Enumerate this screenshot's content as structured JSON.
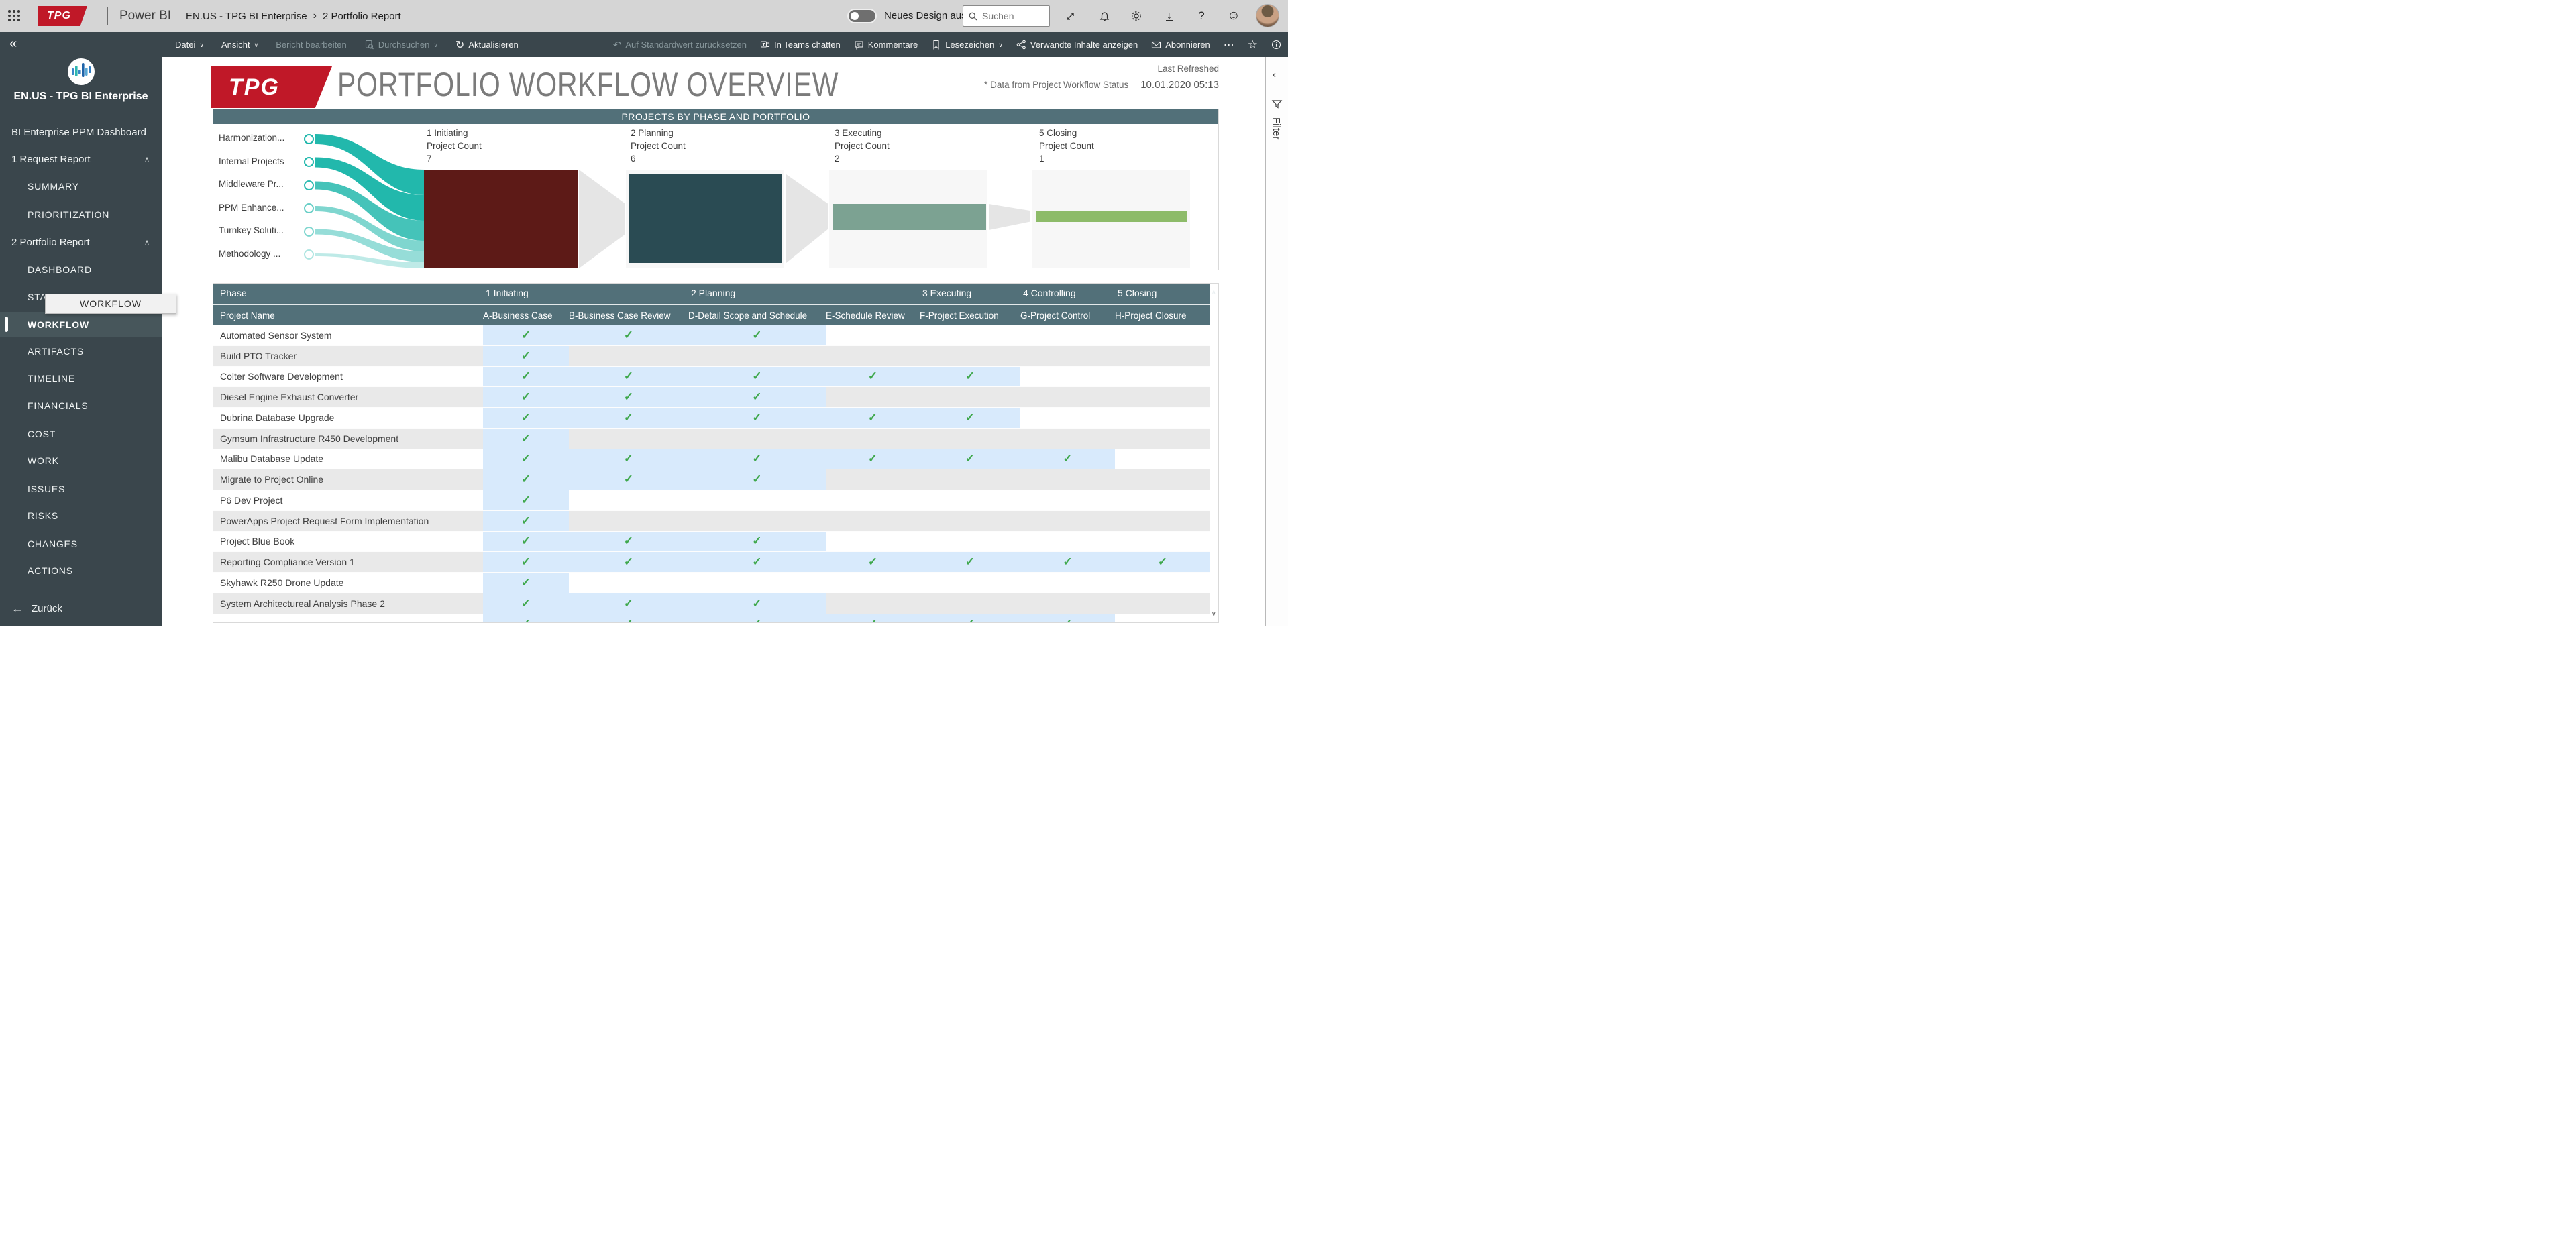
{
  "topbar": {
    "logo_text": "TPG",
    "app_name": "Power BI",
    "breadcrumb": {
      "group": "EN.US - TPG BI Enterprise",
      "separator": "›",
      "page": "2 Portfolio Report"
    },
    "new_design_label": "Neues Design aus",
    "search": {
      "placeholder": "Suchen"
    }
  },
  "toolbar": {
    "file_label": "Datei",
    "view_label": "Ansicht",
    "edit_report_label": "Bericht bearbeiten",
    "explore_label": "Durchsuchen",
    "refresh_label": "Aktualisieren",
    "reset_label": "Auf Standardwert zurücksetzen",
    "teams_label": "In Teams chatten",
    "comments_label": "Kommentare",
    "bookmarks_label": "Lesezeichen",
    "related_label": "Verwandte Inhalte anzeigen",
    "subscribe_label": "Abonnieren",
    "more_label": "⋯"
  },
  "sidebar": {
    "workspace_title": "EN.US - TPG BI Enterprise",
    "dashboard_link": "BI Enterprise PPM Dashboard",
    "sections": [
      {
        "label": "1 Request Report",
        "items": [
          "SUMMARY",
          "PRIORITIZATION"
        ]
      },
      {
        "label": "2 Portfolio Report",
        "items": [
          "DASHBOARD",
          "STATUS",
          "WORKFLOW",
          "ARTIFACTS",
          "TIMELINE",
          "FINANCIALS",
          "COST",
          "WORK",
          "ISSUES",
          "RISKS",
          "CHANGES",
          "ACTIONS"
        ]
      }
    ],
    "active_item": "WORKFLOW",
    "tooltip_text": "WORKFLOW",
    "back_label": "Zurück"
  },
  "report": {
    "logo_text": "TPG",
    "title": "PORTFOLIO WORKFLOW OVERVIEW",
    "last_refreshed_label": "Last Refreshed",
    "last_refreshed_value": "10.01.2020 05:13",
    "data_note": "* Data from Project Workflow Status",
    "filter_panel_label": "Filter"
  },
  "chart_data": {
    "type": "funnel",
    "title": "PROJECTS BY PHASE AND PORTFOLIO",
    "portfolios": [
      "Harmonization...",
      "Internal Projects",
      "Middleware Pr...",
      "PPM Enhance...",
      "Turnkey Soluti...",
      "Methodology ..."
    ],
    "stages": [
      {
        "phase": "1 Initiating",
        "metric": "Project Count",
        "value": "7",
        "color": "#5d1a17"
      },
      {
        "phase": "2 Planning",
        "metric": "Project Count",
        "value": "6",
        "color": "#2a4b53"
      },
      {
        "phase": "3 Executing",
        "metric": "Project Count",
        "value": "2",
        "color": "#7ca292"
      },
      {
        "phase": "5 Closing",
        "metric": "Project Count",
        "value": "1",
        "color": "#8dbb69"
      }
    ],
    "flow_color": "#16b4a8",
    "legend_position": "none",
    "grid": false
  },
  "table": {
    "phase_col_label": "Phase",
    "phase_groups": [
      "1 Initiating",
      "2 Planning",
      "3 Executing",
      "4 Controlling",
      "5 Closing"
    ],
    "name_col_label": "Project Name",
    "step_columns": [
      "A-Business Case",
      "B-Business Case Review",
      "D-Detail Scope and Schedule",
      "E-Schedule Review",
      "F-Project Execution",
      "G-Project Control",
      "H-Project Closure"
    ],
    "check_glyph": "✓",
    "rows": [
      {
        "name": "Automated Sensor System",
        "checks": [
          0,
          1,
          2
        ]
      },
      {
        "name": "Build PTO Tracker",
        "checks": [
          0
        ]
      },
      {
        "name": "Colter Software Development",
        "checks": [
          0,
          1,
          2,
          3,
          4
        ]
      },
      {
        "name": "Diesel Engine Exhaust Converter",
        "checks": [
          0,
          1,
          2
        ]
      },
      {
        "name": "Dubrina Database Upgrade",
        "checks": [
          0,
          1,
          2,
          3,
          4
        ]
      },
      {
        "name": "Gymsum Infrastructure R450 Development",
        "checks": [
          0
        ]
      },
      {
        "name": "Malibu Database Update",
        "checks": [
          0,
          1,
          2,
          3,
          4,
          5
        ]
      },
      {
        "name": "Migrate to Project Online",
        "checks": [
          0,
          1,
          2
        ]
      },
      {
        "name": "P6 Dev Project",
        "checks": [
          0
        ]
      },
      {
        "name": "PowerApps Project Request Form Implementation",
        "checks": [
          0
        ]
      },
      {
        "name": "Project Blue Book",
        "checks": [
          0,
          1,
          2
        ]
      },
      {
        "name": "Reporting Compliance Version 1",
        "checks": [
          0,
          1,
          2,
          3,
          4,
          5,
          6
        ]
      },
      {
        "name": "Skyhawk R250 Drone Update",
        "checks": [
          0
        ]
      },
      {
        "name": "System Architectureal Analysis Phase 2",
        "checks": [
          0,
          1,
          2
        ]
      },
      {
        "name": "",
        "checks": [
          0,
          1,
          2,
          3,
          4,
          5
        ]
      }
    ]
  },
  "icons": {
    "collapse": "«",
    "back_arrow": "←",
    "chevron_down": "∨",
    "chevron_up": "∧",
    "chevron_left": "‹",
    "refresh": "↻",
    "undo": "↶",
    "more": "⋯",
    "star": "☆",
    "download": "↓",
    "question": "?",
    "smiley": "☺",
    "scroll_up": "∧",
    "scroll_down": "∨"
  },
  "colors": {
    "chrome_dark": "#3a464c",
    "header_teal": "#527079",
    "brand_red": "#c01828",
    "highlight_blue": "#d8eafc",
    "row_alt": "#e9e9e9",
    "check_green": "#3fa84c",
    "flow_teal": "#16b4a8"
  }
}
